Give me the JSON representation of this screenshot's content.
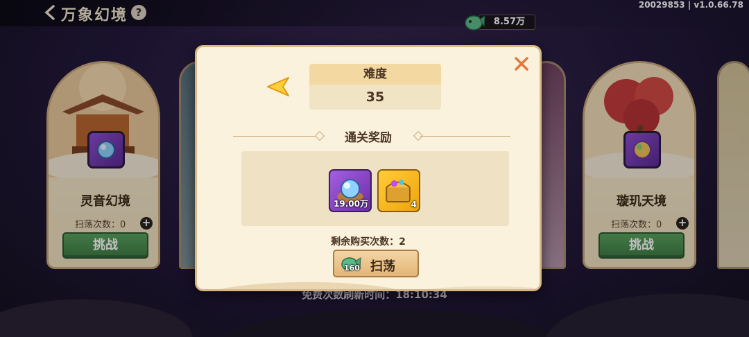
{
  "header": {
    "title": "万象幻境",
    "help": "?",
    "build": "20029853 | v1.0.66.78"
  },
  "currency": {
    "value": "8.57万"
  },
  "cards": [
    {
      "name": "灵音幻境",
      "sweep_label": "扫荡次数：0",
      "challenge": "挑战"
    },
    {
      "name": "璇玑天境",
      "sweep_label": "扫荡次数：0",
      "challenge": "挑战"
    }
  ],
  "refresh": {
    "text": "免费次数刷新时间：18:10:34"
  },
  "modal": {
    "difficulty_label": "难度",
    "difficulty_value": "35",
    "section_title": "通关奖励",
    "rewards": [
      {
        "icon": "spirit-orb-icon",
        "count": "19.00万"
      },
      {
        "icon": "treasure-chest-icon",
        "count": "4"
      }
    ],
    "remaining": "剩余购买次数：2",
    "sweep_cost": "160",
    "sweep_label": "扫荡"
  },
  "colors": {
    "accent": "#4f9456",
    "panel": "#fbf2de",
    "gold": "#f3d9a1"
  }
}
